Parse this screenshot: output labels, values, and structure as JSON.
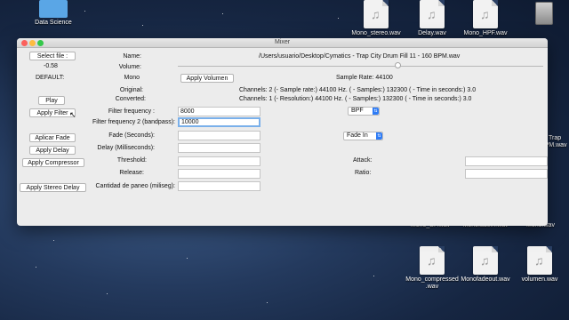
{
  "desktop": {
    "icons": [
      {
        "label": "Data Science",
        "kind": "folder"
      },
      {
        "label": "Mono_stereo.wav",
        "kind": "audio"
      },
      {
        "label": "Delay.wav",
        "kind": "audio"
      },
      {
        "label": "Mono_HPF.wav",
        "kind": "audio"
      },
      {
        "label": "Mono_BP.wav",
        "kind": "audio"
      },
      {
        "label": "Monofadein.wav",
        "kind": "audio"
      },
      {
        "label": "Mono.wav",
        "kind": "audio"
      },
      {
        "label": "Mono_compressed .wav",
        "kind": "audio"
      },
      {
        "label": "Monofadeout.wav",
        "kind": "audio"
      },
      {
        "label": "volumen.wav",
        "kind": "audio"
      },
      {
        "label": "- Trap BPM.wav",
        "kind": "audio"
      }
    ]
  },
  "window": {
    "title": "Mixer"
  },
  "left": {
    "select_file": "Select file :",
    "volume_value": "-0.58",
    "default_label": "DEFAULT:",
    "play": "Play",
    "apply_filter": "Apply Filter",
    "aplicar_fade": "Aplicar Fade",
    "apply_delay": "Apply Delay",
    "apply_compressor": "Apply Compressor",
    "apply_stereo_delay": "Apply Stereo Delay"
  },
  "info": {
    "name_label": "Name:",
    "name_value": "/Users/usuario/Desktop/Cymatics - Trap City Drum Fill 11 - 160 BPM.wav",
    "volume_label": "Volume:",
    "volume_fraction": 0.6,
    "mono_label": "Mono",
    "apply_volumen": "Apply Volumen",
    "sample_rate": "Sample Rate: 44100",
    "original_label": "Original:",
    "original_value": "Channels: 2 (- Sample rate:) 44100 Hz. ( - Samples:) 132300 ( - Time in seconds:) 3.0",
    "converted_label": "Converted:",
    "converted_value": "Channels: 1 (- Resolution:) 44100 Hz. ( - Samples:) 132300 ( - Time in seconds:) 3.0"
  },
  "params": {
    "filter_freq_label": "Filter frequency :",
    "filter_freq_value": "8000",
    "filter_type": "BPF",
    "filter_freq2_label": "Filter frequency 2 (bandpass):",
    "filter_freq2_value": "10000",
    "fade_label": "Fade (Seconds):",
    "fade_value": "",
    "fade_type": "Fade In",
    "delay_label": "Delay (Milliseconds):",
    "delay_value": "",
    "threshold_label": "Threshold:",
    "threshold_value": "",
    "attack_label": "Attack:",
    "attack_value": "",
    "release_label": "Release:",
    "release_value": "",
    "ratio_label": "Ratio:",
    "ratio_value": "",
    "paneo_label": "Cantidad de paneo (miliseg):",
    "paneo_value": ""
  }
}
